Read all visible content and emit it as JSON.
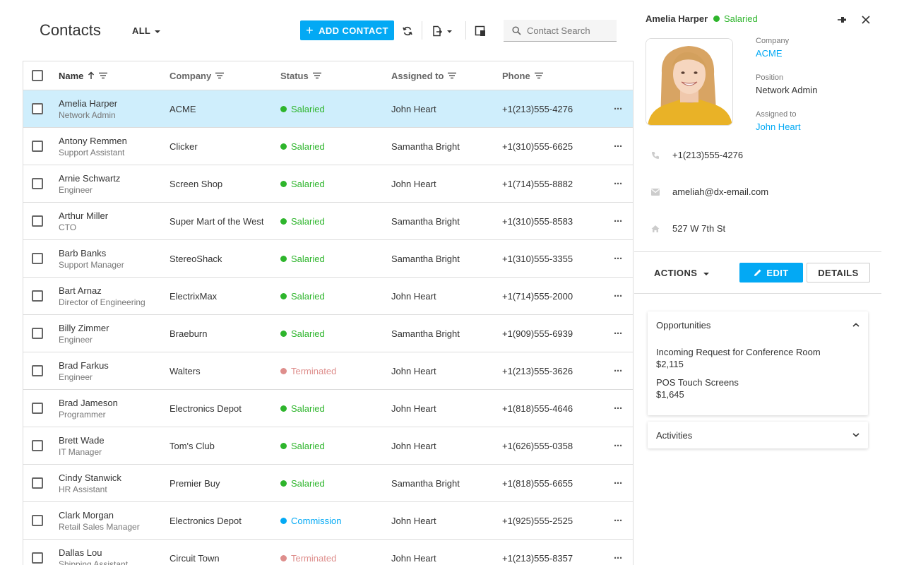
{
  "toolbar": {
    "title": "Contacts",
    "filter_label": "ALL",
    "add_label": "ADD CONTACT",
    "search_placeholder": "Contact Search"
  },
  "grid": {
    "headers": {
      "name": "Name",
      "company": "Company",
      "status": "Status",
      "assigned": "Assigned to",
      "phone": "Phone"
    },
    "rows": [
      {
        "name": "Amelia Harper",
        "position": "Network Admin",
        "company": "ACME",
        "status": "Salaried",
        "assigned": "John Heart",
        "phone": "+1(213)555-4276"
      },
      {
        "name": "Antony Remmen",
        "position": "Support Assistant",
        "company": "Clicker",
        "status": "Salaried",
        "assigned": "Samantha Bright",
        "phone": "+1(310)555-6625"
      },
      {
        "name": "Arnie Schwartz",
        "position": "Engineer",
        "company": "Screen Shop",
        "status": "Salaried",
        "assigned": "John Heart",
        "phone": "+1(714)555-8882"
      },
      {
        "name": "Arthur Miller",
        "position": "CTO",
        "company": "Super Mart of the West",
        "status": "Salaried",
        "assigned": "Samantha Bright",
        "phone": "+1(310)555-8583"
      },
      {
        "name": "Barb Banks",
        "position": "Support Manager",
        "company": "StereoShack",
        "status": "Salaried",
        "assigned": "Samantha Bright",
        "phone": "+1(310)555-3355"
      },
      {
        "name": "Bart Arnaz",
        "position": "Director of Engineering",
        "company": "ElectrixMax",
        "status": "Salaried",
        "assigned": "John Heart",
        "phone": "+1(714)555-2000"
      },
      {
        "name": "Billy Zimmer",
        "position": "Engineer",
        "company": "Braeburn",
        "status": "Salaried",
        "assigned": "Samantha Bright",
        "phone": "+1(909)555-6939"
      },
      {
        "name": "Brad Farkus",
        "position": "Engineer",
        "company": "Walters",
        "status": "Terminated",
        "assigned": "John Heart",
        "phone": "+1(213)555-3626"
      },
      {
        "name": "Brad Jameson",
        "position": "Programmer",
        "company": "Electronics Depot",
        "status": "Salaried",
        "assigned": "John Heart",
        "phone": "+1(818)555-4646"
      },
      {
        "name": "Brett Wade",
        "position": "IT Manager",
        "company": "Tom's Club",
        "status": "Salaried",
        "assigned": "John Heart",
        "phone": "+1(626)555-0358"
      },
      {
        "name": "Cindy Stanwick",
        "position": "HR Assistant",
        "company": "Premier Buy",
        "status": "Salaried",
        "assigned": "Samantha Bright",
        "phone": "+1(818)555-6655"
      },
      {
        "name": "Clark Morgan",
        "position": "Retail Sales Manager",
        "company": "Electronics Depot",
        "status": "Commission",
        "assigned": "John Heart",
        "phone": "+1(925)555-2525"
      },
      {
        "name": "Dallas Lou",
        "position": "Shipping Assistant",
        "company": "Circuit Town",
        "status": "Terminated",
        "assigned": "John Heart",
        "phone": "+1(213)555-8357"
      }
    ]
  },
  "status_colors": {
    "Salaried": "#2eb52c",
    "Terminated": "#de8e8c",
    "Commission": "#03a9f4"
  },
  "panel": {
    "name": "Amelia Harper",
    "status": "Salaried",
    "company_label": "Company",
    "company": "ACME",
    "position_label": "Position",
    "position": "Network Admin",
    "assigned_label": "Assigned to",
    "assigned": "John Heart",
    "phone": "+1(213)555-4276",
    "email": "ameliah@dx-email.com",
    "address": "527 W 7th St",
    "actions_label": "ACTIONS",
    "edit_label": "EDIT",
    "details_label": "DETAILS",
    "opportunities_title": "Opportunities",
    "opportunities": [
      {
        "title": "Incoming Request for Conference Room",
        "amount": "$2,115"
      },
      {
        "title": "POS Touch Screens",
        "amount": "$1,645"
      }
    ],
    "activities_title": "Activities"
  },
  "colors": {
    "accent": "#03a9f4",
    "selected_row": "#cfeefc"
  }
}
